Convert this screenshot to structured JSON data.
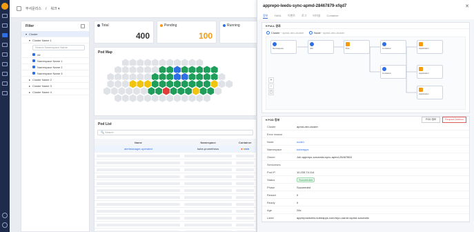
{
  "topbar": {
    "crumb1": "무서운리스",
    "crumb2": "워크 ▾"
  },
  "filter": {
    "title": "Filter",
    "root": "Cluster",
    "cluster1": "Cluster Name 1",
    "search_placeholder": "Search Namespace Name",
    "items": [
      "All",
      "Namespace Name 1",
      "Namespace Name 2",
      "Namespace Name 3"
    ],
    "cluster2": "Cluster Name 2",
    "cluster3": "Cluster Name 3",
    "cluster4": "Cluster Name 4"
  },
  "cards": [
    {
      "label": "Total",
      "value": "400",
      "color": "#4a5568"
    },
    {
      "label": "Pending",
      "value": "100",
      "color": "#f39c12"
    },
    {
      "label": "Running",
      "value": "",
      "color": "#2f6fe4"
    }
  ],
  "podmap": {
    "title": "Pod Map"
  },
  "podlist": {
    "title": "Pod List",
    "search_placeholder": "Search",
    "headers": [
      "Name",
      "Namespace",
      "Container"
    ],
    "first_row": {
      "name": "alertmanager-operated",
      "namespace": "kube-prometheus"
    }
  },
  "drawer": {
    "title": "apprepo-leeds-sync-apmd-28467879-xfqd7",
    "tabs": [
      "정보",
      "YAML",
      "이벤트",
      "로그",
      "터미널",
      "Container"
    ],
    "topology_title": "FULL 경로",
    "radio_cluster": "Cluster",
    "radio_cluster_val": "apmd-dev-cluster",
    "radio_node": "Node",
    "radio_node_val": "apmd-dev-cluster",
    "info_title": "POD 정보",
    "select": "POD 정보",
    "request_btn": "Request Deletion",
    "info": [
      {
        "k": "Cluster",
        "v": "apmd-dev-cluster"
      },
      {
        "k": "Error reason",
        "v": ""
      },
      {
        "k": "Node",
        "v": "node1"
      },
      {
        "k": "Namespace",
        "v": "kubeapps"
      },
      {
        "k": "Owner",
        "v": "Job apprepo-sorceatio-sync-apmd-28467863"
      },
      {
        "k": "Serviceses",
        "v": ""
      },
      {
        "k": "Pod IP",
        "v": "10.233.74.114"
      },
      {
        "k": "Status",
        "v": "Succeeded"
      },
      {
        "k": "Phase",
        "v": "Succeeded"
      },
      {
        "k": "Restart",
        "v": "0"
      },
      {
        "k": "Ready",
        "v": "0"
      },
      {
        "k": "Age",
        "v": "24s"
      },
      {
        "k": "Label",
        "v": "apprepositories.kubeapps.com/repo-name=apmd-sorceatio"
      }
    ]
  },
  "colors": {
    "green": "#1e9e5a",
    "yellow": "#f1c40f",
    "red": "#e23b3b",
    "blue": "#2f6fe4",
    "grey": "#dfe2e7"
  }
}
